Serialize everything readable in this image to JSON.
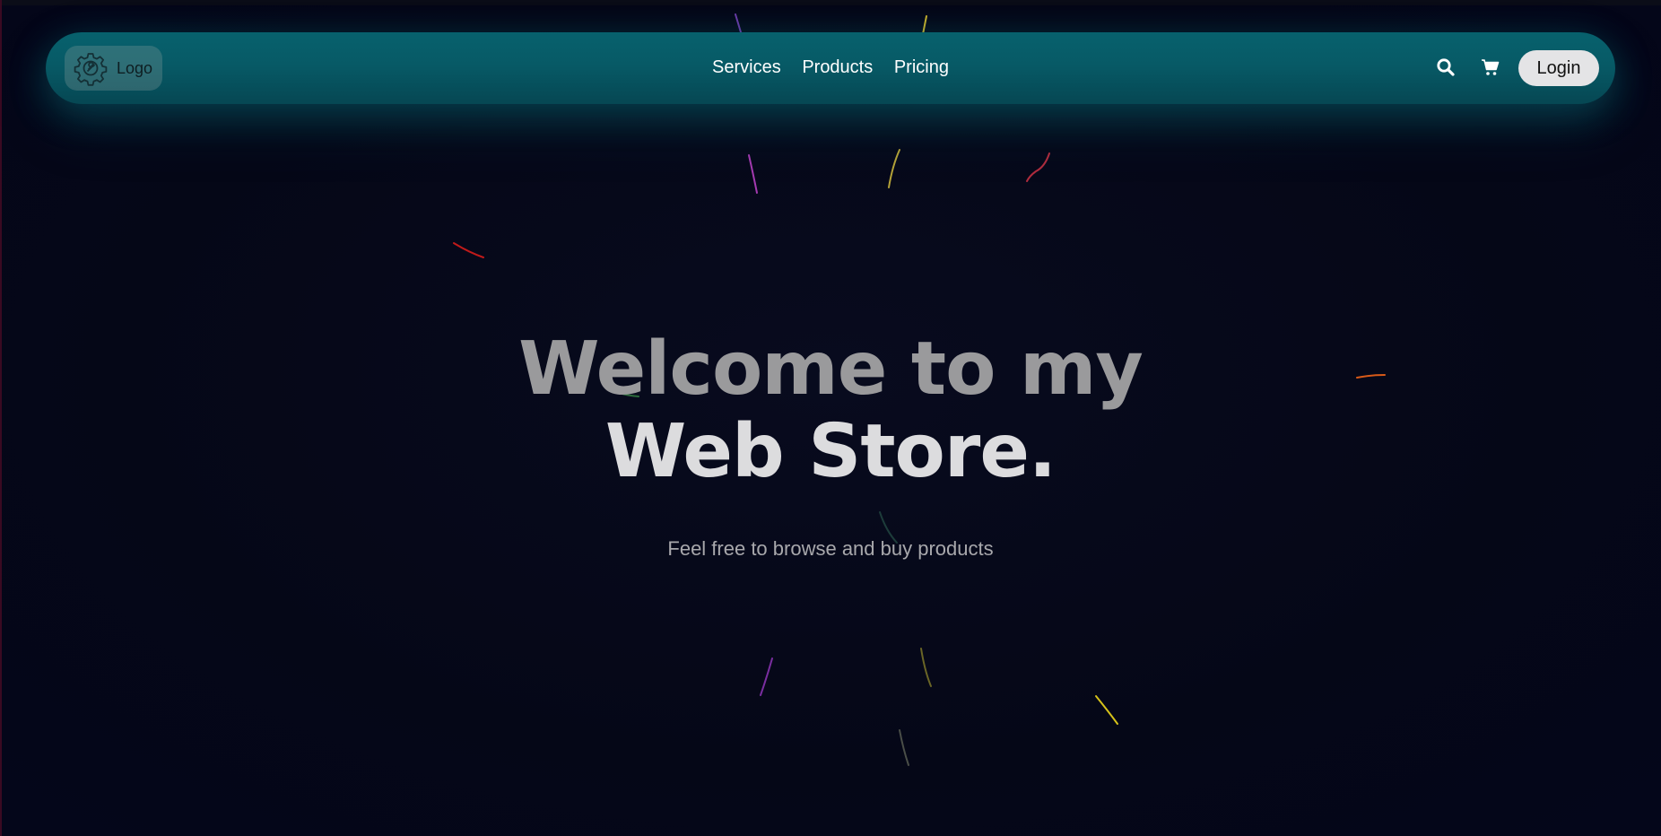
{
  "nav": {
    "logo_label": "Logo",
    "logo_icon": "gear-wrench-icon",
    "links": [
      "Services",
      "Products",
      "Pricing"
    ],
    "search_icon": "search-icon",
    "cart_icon": "cart-icon",
    "login_label": "Login"
  },
  "hero": {
    "title_line1": "Welcome to my",
    "title_line2": "Web Store.",
    "subtitle": "Feel free to browse and buy products"
  },
  "colors": {
    "background": "#050717",
    "navbar_teal": "#07616d",
    "login_button_bg": "#e4e4e6"
  }
}
